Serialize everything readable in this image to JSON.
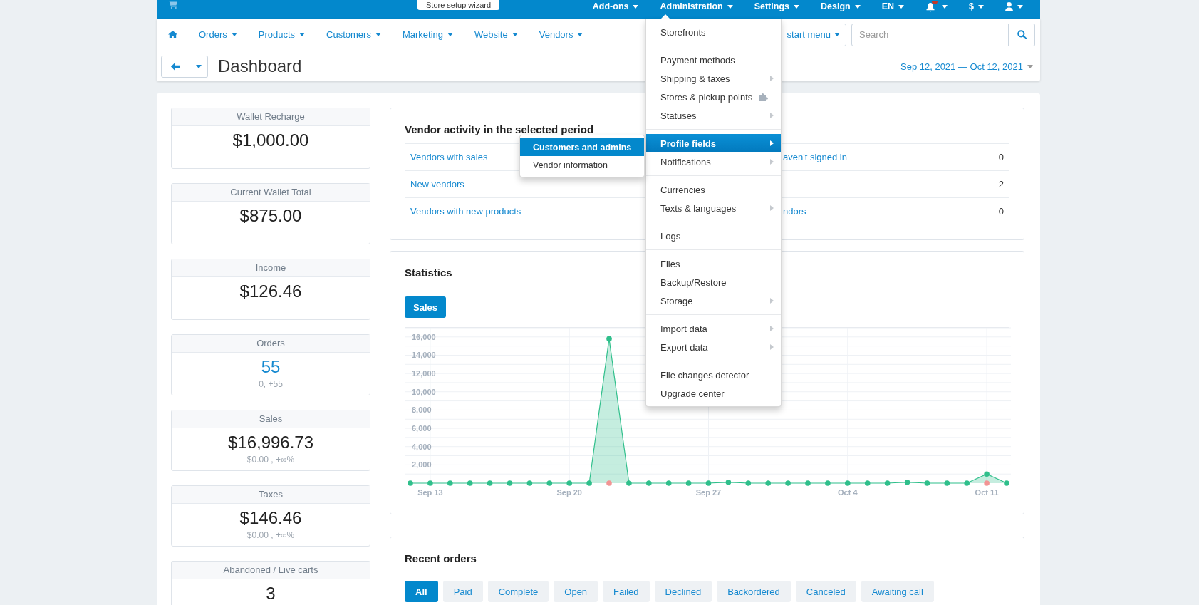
{
  "top_bar": {
    "wizard_button": "Store setup wizard",
    "menus": [
      {
        "label": "Add-ons",
        "expanded": false
      },
      {
        "label": "Administration",
        "expanded": true,
        "groups": [
          [
            {
              "label": "Storefronts",
              "kind": "plain",
              "selected": false
            }
          ],
          [
            {
              "label": "Payment methods",
              "kind": "plain",
              "selected": false
            },
            {
              "label": "Shipping & taxes",
              "kind": "submenu",
              "selected": false
            },
            {
              "label": "Stores & pickup points",
              "kind": "addon",
              "selected": false
            },
            {
              "label": "Statuses",
              "kind": "submenu",
              "selected": false
            }
          ],
          [
            {
              "label": "Profile fields",
              "kind": "submenu",
              "selected": true,
              "submenu": [
                {
                  "label": "Customers and admins",
                  "selected": true
                },
                {
                  "label": "Vendor information",
                  "selected": false
                }
              ]
            },
            {
              "label": "Notifications",
              "kind": "submenu",
              "selected": false
            }
          ],
          [
            {
              "label": "Currencies",
              "kind": "plain",
              "selected": false
            },
            {
              "label": "Texts & languages",
              "kind": "submenu",
              "selected": false
            }
          ],
          [
            {
              "label": "Logs",
              "kind": "plain",
              "selected": false
            }
          ],
          [
            {
              "label": "Files",
              "kind": "plain",
              "selected": false
            },
            {
              "label": "Backup/Restore",
              "kind": "plain",
              "selected": false
            },
            {
              "label": "Storage",
              "kind": "submenu",
              "selected": false
            }
          ],
          [
            {
              "label": "Import data",
              "kind": "submenu",
              "selected": false
            },
            {
              "label": "Export data",
              "kind": "submenu",
              "selected": false
            }
          ],
          [
            {
              "label": "File changes detector",
              "kind": "plain",
              "selected": false
            },
            {
              "label": "Upgrade center",
              "kind": "plain",
              "selected": false
            }
          ]
        ]
      },
      {
        "label": "Settings",
        "expanded": false
      },
      {
        "label": "Design",
        "expanded": false
      },
      {
        "label": "EN",
        "expanded": false
      }
    ],
    "currency": "$"
  },
  "nav": {
    "items": [
      "Orders",
      "Products",
      "Customers",
      "Marketing",
      "Website",
      "Vendors"
    ],
    "quick_menu": "start menu",
    "search": {
      "placeholder": "Search"
    }
  },
  "header": {
    "title": "Dashboard",
    "date_range": "Sep 12, 2021 — Oct 12, 2021"
  },
  "stat_cards": [
    {
      "title": "Wallet Recharge",
      "value": "$1,000.00",
      "kind": "plain"
    },
    {
      "title": "Current Wallet Total",
      "value": "$875.00",
      "kind": "plain"
    },
    {
      "title": "Income",
      "value": "$126.46",
      "kind": "plain"
    },
    {
      "title": "Orders",
      "value": "55",
      "kind": "link",
      "detail": "0, +55"
    },
    {
      "title": "Sales",
      "value": "$16,996.73",
      "kind": "plain",
      "detail": "$0.00 , +∞%"
    },
    {
      "title": "Taxes",
      "value": "$146.46",
      "kind": "plain",
      "detail": "$0.00 , +∞%"
    },
    {
      "title": "Abandoned / Live carts",
      "value": "3",
      "kind": "plain"
    }
  ],
  "vendor_activity": {
    "title": "Vendor activity in the selected period",
    "rows": [
      {
        "label": "Vendors with sales",
        "right_label": "aven't signed in",
        "right_value": "0"
      },
      {
        "label": "New vendors",
        "right_value": "2"
      },
      {
        "label": "Vendors with new products",
        "right_label": "ndors",
        "right_value": "0"
      }
    ]
  },
  "statistics": {
    "title": "Statistics",
    "tabs": [
      {
        "label": "Sales",
        "selected": true
      }
    ],
    "chart_data": {
      "type": "area",
      "categories": [
        null,
        "Sep 13",
        null,
        null,
        null,
        null,
        null,
        null,
        "Sep 20",
        null,
        null,
        null,
        null,
        null,
        null,
        "Sep 27",
        null,
        null,
        null,
        null,
        null,
        null,
        "Oct 4",
        null,
        null,
        null,
        null,
        null,
        null,
        "Oct 11",
        null
      ],
      "series": [
        {
          "color": "#2fbf8b",
          "values": [
            0,
            0,
            0,
            0,
            0,
            0,
            0,
            0,
            0,
            0,
            15800,
            0,
            0,
            0,
            0,
            0,
            100,
            0,
            0,
            0,
            0,
            0,
            0,
            0,
            0,
            100,
            0,
            0,
            0,
            1000,
            0
          ]
        },
        {
          "type": "scatter",
          "color": "#f29494",
          "values": [
            null,
            null,
            null,
            null,
            null,
            null,
            null,
            null,
            null,
            null,
            0,
            null,
            null,
            null,
            null,
            null,
            null,
            null,
            null,
            null,
            null,
            null,
            null,
            null,
            null,
            null,
            null,
            null,
            null,
            0,
            null
          ]
        }
      ],
      "ylim": [
        0,
        17000
      ],
      "yticks": [
        {
          "value": 2000,
          "label": "2,000"
        },
        {
          "value": 4000,
          "label": "4,000"
        },
        {
          "value": 6000,
          "label": "6,000"
        },
        {
          "value": 8000,
          "label": "8,000"
        },
        {
          "value": 10000,
          "label": "10,000"
        },
        {
          "value": 12000,
          "label": "12,000"
        },
        {
          "value": 14000,
          "label": "14,000"
        },
        {
          "value": 16000,
          "label": "16,000"
        }
      ],
      "grid": true
    }
  },
  "recent_orders": {
    "title": "Recent orders",
    "filters": [
      {
        "label": "All",
        "selected": true
      },
      {
        "label": "Paid",
        "selected": false
      },
      {
        "label": "Complete",
        "selected": false
      },
      {
        "label": "Open",
        "selected": false
      },
      {
        "label": "Failed",
        "selected": false
      },
      {
        "label": "Declined",
        "selected": false
      },
      {
        "label": "Backordered",
        "selected": false
      },
      {
        "label": "Canceled",
        "selected": false
      },
      {
        "label": "Awaiting call",
        "selected": false
      }
    ]
  }
}
